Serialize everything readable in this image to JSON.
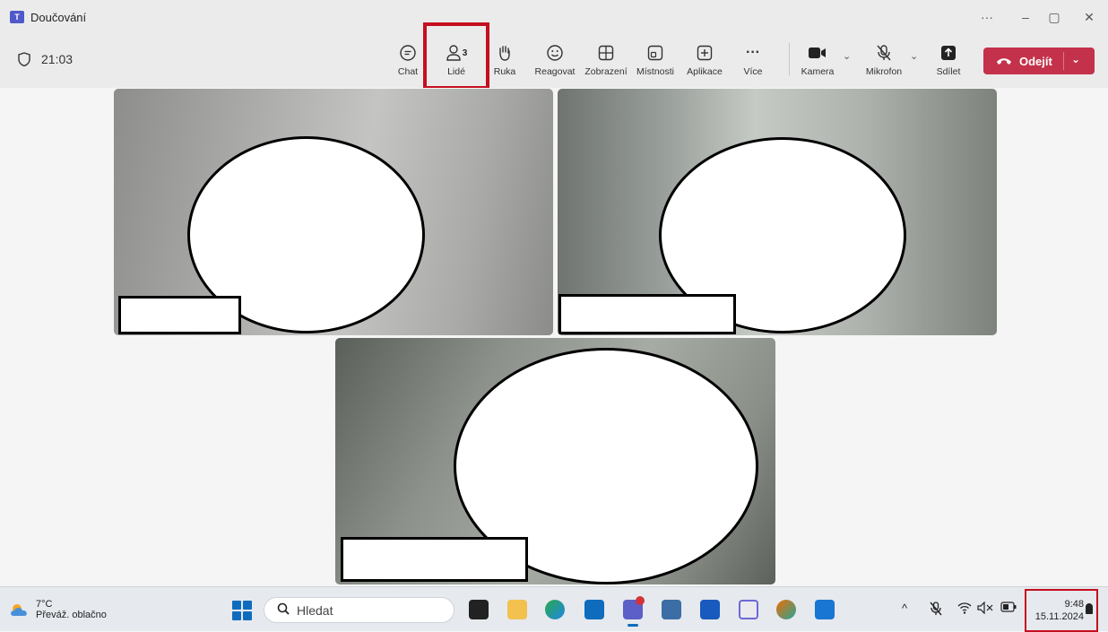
{
  "window": {
    "title": "Doučování",
    "controls": [
      "···",
      "–",
      "▢",
      "✕"
    ]
  },
  "toolbar": {
    "timer": "21:03",
    "buttons": [
      {
        "label": "Chat",
        "icon": "chat-icon"
      },
      {
        "label": "Lidé",
        "icon": "people-icon",
        "count": "3"
      },
      {
        "label": "Ruka",
        "icon": "raise-hand-icon"
      },
      {
        "label": "Reagovat",
        "icon": "reaction-icon"
      },
      {
        "label": "Zobrazení",
        "icon": "view-icon"
      },
      {
        "label": "Místnosti",
        "icon": "rooms-icon"
      },
      {
        "label": "Aplikace",
        "icon": "apps-icon"
      },
      {
        "label": "Více",
        "icon": "more-icon"
      },
      {
        "label": "Kamera",
        "icon": "camera-icon"
      },
      {
        "label": "Mikrofon",
        "icon": "mic-off-icon"
      },
      {
        "label": "Sdílet",
        "icon": "share-icon"
      }
    ],
    "leave_label": "Odejít",
    "leave_color": "#c4314b",
    "highlight_color": "#c50f1f"
  },
  "taskbar": {
    "weather": {
      "temp": "7°C",
      "desc": "Převáž. oblačno"
    },
    "search_placeholder": "Hledat",
    "clock": {
      "time": "9:48",
      "date": "15.11.2024"
    }
  }
}
